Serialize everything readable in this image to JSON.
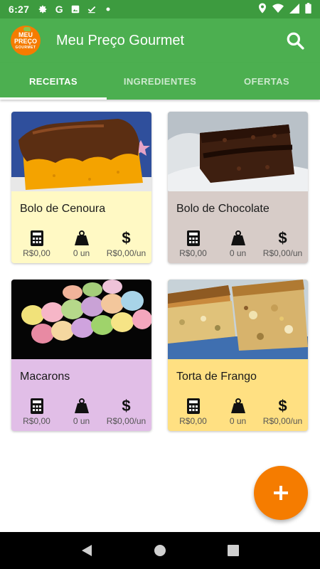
{
  "status_bar": {
    "time": "6:27",
    "icons": [
      "gear-icon",
      "google-icon",
      "gallery-icon",
      "download-done-icon",
      "dot-icon"
    ],
    "right_icons": [
      "location-icon",
      "wifi-icon",
      "signal-icon",
      "battery-icon"
    ]
  },
  "app_bar": {
    "logo_line1": "MEU",
    "logo_line2": "PREÇO",
    "logo_line3": "GOURMET",
    "title": "Meu Preço Gourmet",
    "search_icon": "search-icon"
  },
  "tabs": [
    {
      "label": "RECEITAS",
      "active": true
    },
    {
      "label": "INGREDIENTES",
      "active": false
    },
    {
      "label": "OFERTAS",
      "active": false
    }
  ],
  "recipes": [
    {
      "name": "Bolo de Cenoura",
      "bg": "#fff9c4",
      "cost": "R$0,00",
      "units": "0 un",
      "unit_price": "R$0,00/un"
    },
    {
      "name": "Bolo de Chocolate",
      "bg": "#d7ccc8",
      "cost": "R$0,00",
      "units": "0 un",
      "unit_price": "R$0,00/un"
    },
    {
      "name": "Macarons",
      "bg": "#e1bee7",
      "cost": "R$0,00",
      "units": "0 un",
      "unit_price": "R$0,00/un"
    },
    {
      "name": "Torta de Frango",
      "bg": "#ffe082",
      "cost": "R$0,00",
      "units": "0 un",
      "unit_price": "R$0,00/un"
    }
  ],
  "stat_icons": [
    "calculator-icon",
    "weight-icon",
    "dollar-icon"
  ],
  "fab": {
    "icon": "plus-icon"
  },
  "nav_bar": {
    "icons": [
      "back-icon",
      "home-icon",
      "recents-icon"
    ]
  },
  "colors": {
    "primary": "#4caf50",
    "status": "#3d9b3f",
    "accent": "#f57c00"
  }
}
